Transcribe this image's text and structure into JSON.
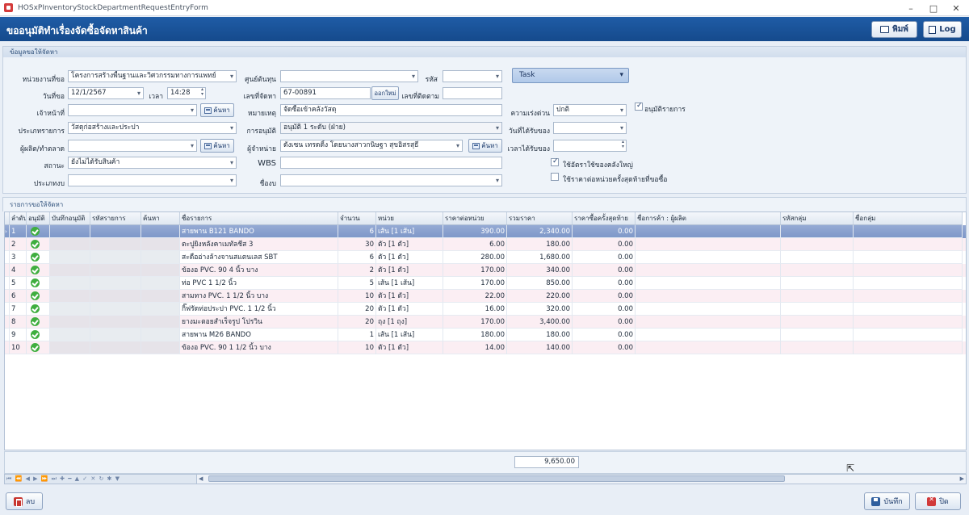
{
  "window": {
    "title": "HOSxPInventoryStockDepartmentRequestEntryForm"
  },
  "header": {
    "title": "ขออนุมัติทำเรื่องจัดซื้อจัดหาสินค้า",
    "print_label": "พิมพ์",
    "log_label": "Log"
  },
  "info_group": {
    "caption": "ข้อมูลขอให้จัดหา",
    "labels": {
      "unit": "หน่วยงานที่ขอ",
      "cost_center": "ศูนย์ต้นทุน",
      "code": "รหัส",
      "date": "วันที่ขอ",
      "time": "เวลา",
      "request_no": "เลขที่จัดหา",
      "tracking_no": "เลขที่ติดตาม",
      "officer": "เจ้าหน้าที่",
      "note": "หมายเหตุ",
      "urgency": "ความเร่งด่วน",
      "item_type": "ประเภทรายการ",
      "approval": "การอนุมัติ",
      "receive_date": "วันที่ได้รับของ",
      "manufacturer": "ผู้ผลิต/ทำตลาด",
      "supplier": "ผู้จำหน่าย",
      "receive_time": "เวลาได้รับของ",
      "status": "สถานะ",
      "wbs": "WBS",
      "budget_type": "ประเภทงบ",
      "budget_name": "ชื่องบ"
    },
    "values": {
      "unit": "โครงการสร้างพื้นฐานและวิศวกรรมทางการแพทย์",
      "cost_center": "",
      "code": "",
      "date": "12/1/2567",
      "time": "14:28",
      "request_no": "67-00891",
      "tracking_no": "",
      "officer": "",
      "note": "จัดซื้อเข้าคลังวัสดุ",
      "urgency": "ปกติ",
      "item_type": "วัสดุก่อสร้างและประปา",
      "approval": "อนุมัติ 1 ระดับ (ฝ่าย)",
      "receive_date": "",
      "manufacturer": "",
      "supplier": "ดังเซน เทรดดิ้ง โดยนางสาวกนิษฐา สุขอิสรสุธี",
      "receive_time": "",
      "status": "ยังไม่ได้รับสินค้า",
      "wbs": "",
      "budget_type": "",
      "budget_name": ""
    },
    "task_label": "Task",
    "new_no_button": "ออกใหม่",
    "search_button": "ค้นหา",
    "approve_items_label": "อนุมัติรายการ",
    "approve_items_checked": true,
    "use_large_unit_label": "ใช้อัตราใช้ของคลังใหญ่",
    "use_large_unit_checked": true,
    "use_last_price_label": "ใช้ราคาต่อหน่วยครั้งสุดท้ายที่ขอซื้อ",
    "use_last_price_checked": false
  },
  "grid": {
    "caption": "รายการขอให้จัดหา",
    "columns": [
      "ลำดับ",
      "อนุมัติ",
      "บันทึกอนุมัติ",
      "รหัสรายการ",
      "ค้นหา",
      "ชื่อรายการ",
      "จำนวน",
      "หน่วย",
      "ราคาต่อหน่วย",
      "รวมราคา",
      "ราคาซื้อครั้งสุดท้าย",
      "ชื่อการค้า : ผู้ผลิต",
      "รหัสกลุ่ม",
      "ชื่อกลุ่ม"
    ],
    "rows": [
      {
        "no": "1",
        "name": "สายพาน B121 BANDO",
        "qty": "6",
        "unit": "เส้น [1 เส้น]",
        "price": "390.00",
        "total": "2,340.00",
        "last": "0.00"
      },
      {
        "no": "2",
        "name": "ตะปูยิงหลังคาเมทัลชีส 3",
        "qty": "30",
        "unit": "ตัว [1 ตัว]",
        "price": "6.00",
        "total": "180.00",
        "last": "0.00"
      },
      {
        "no": "3",
        "name": "สะดืออ่างล้างจานสแตนเลส SBT",
        "qty": "6",
        "unit": "ตัว [1 ตัว]",
        "price": "280.00",
        "total": "1,680.00",
        "last": "0.00"
      },
      {
        "no": "4",
        "name": "ข้องอ PVC. 90 4 นิ้ว บาง",
        "qty": "2",
        "unit": "ตัว [1 ตัว]",
        "price": "170.00",
        "total": "340.00",
        "last": "0.00"
      },
      {
        "no": "5",
        "name": "ท่อ PVC 1 1/2 นิ้ว",
        "qty": "5",
        "unit": "เส้น [1 เส้น]",
        "price": "170.00",
        "total": "850.00",
        "last": "0.00"
      },
      {
        "no": "6",
        "name": "สามทาง PVC. 1 1/2 นิ้ว บาง",
        "qty": "10",
        "unit": "ตัว [1 ตัว]",
        "price": "22.00",
        "total": "220.00",
        "last": "0.00"
      },
      {
        "no": "7",
        "name": "กิ๊ฟรัดท่อประปา PVC. 1 1/2 นิ้ว",
        "qty": "20",
        "unit": "ตัว [1 ตัว]",
        "price": "16.00",
        "total": "320.00",
        "last": "0.00"
      },
      {
        "no": "8",
        "name": "ยางมะตอยสำเร็จรูป โปรวิน",
        "qty": "20",
        "unit": "ถุง [1 ถุง]",
        "price": "170.00",
        "total": "3,400.00",
        "last": "0.00"
      },
      {
        "no": "9",
        "name": "สายพาน M26 BANDO",
        "qty": "1",
        "unit": "เส้น [1 เส้น]",
        "price": "180.00",
        "total": "180.00",
        "last": "0.00"
      },
      {
        "no": "10",
        "name": "ข้องอ PVC. 90 1 1/2 นิ้ว บาง",
        "qty": "10",
        "unit": "ตัว [1 ตัว]",
        "price": "14.00",
        "total": "140.00",
        "last": "0.00"
      }
    ],
    "total_sum": "9,650.00"
  },
  "footer": {
    "delete_label": "ลบ",
    "save_label": "บันทึก",
    "close_label": "ปิด"
  }
}
